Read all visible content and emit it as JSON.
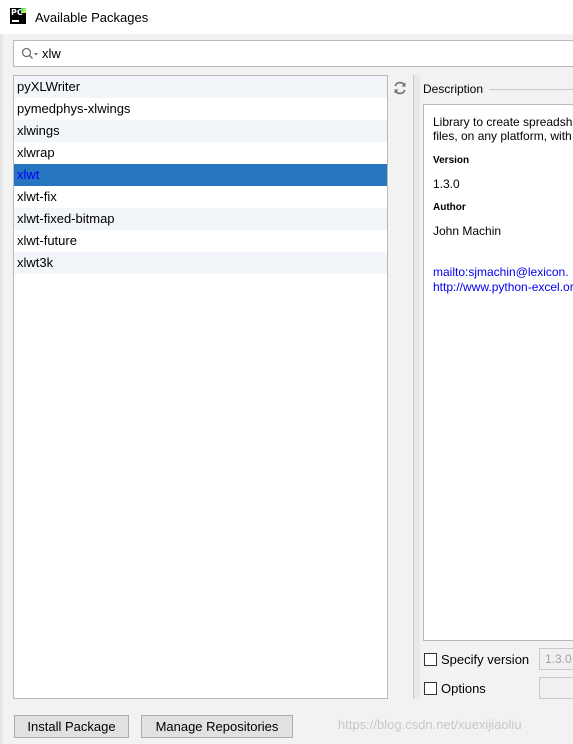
{
  "window": {
    "title": "Available Packages",
    "app_icon_text": "PC"
  },
  "search": {
    "value": "xlw"
  },
  "packages": [
    {
      "name": "pyXLWriter"
    },
    {
      "name": "pymedphys-xlwings"
    },
    {
      "name": "xlwings"
    },
    {
      "name": "xlwrap"
    },
    {
      "name": "xlwt",
      "selected": true
    },
    {
      "name": "xlwt-fix"
    },
    {
      "name": "xlwt-fixed-bitmap"
    },
    {
      "name": "xlwt-future"
    },
    {
      "name": "xlwt3k"
    }
  ],
  "description": {
    "header": "Description",
    "text_line1": "Library to create spreadsh",
    "text_line2": "files, on any platform, with",
    "version_label": "Version",
    "version_value": "1.3.0",
    "author_label": "Author",
    "author_value": "John Machin",
    "link1": "mailto:sjmachin@lexicon.",
    "link2": "http://www.python-excel.or"
  },
  "options": {
    "specify_version_label": "Specify version",
    "specify_version_value": "1.3.0",
    "options_label": "Options"
  },
  "buttons": {
    "install": "Install Package",
    "manage": "Manage Repositories"
  },
  "watermark": "https://blog.csdn.net/xuexijiaoliu",
  "colors": {
    "selection": "#2675bf",
    "selected_text": "#0000ff",
    "alt_row": "#f2f5f9",
    "link": "#0000ee"
  }
}
